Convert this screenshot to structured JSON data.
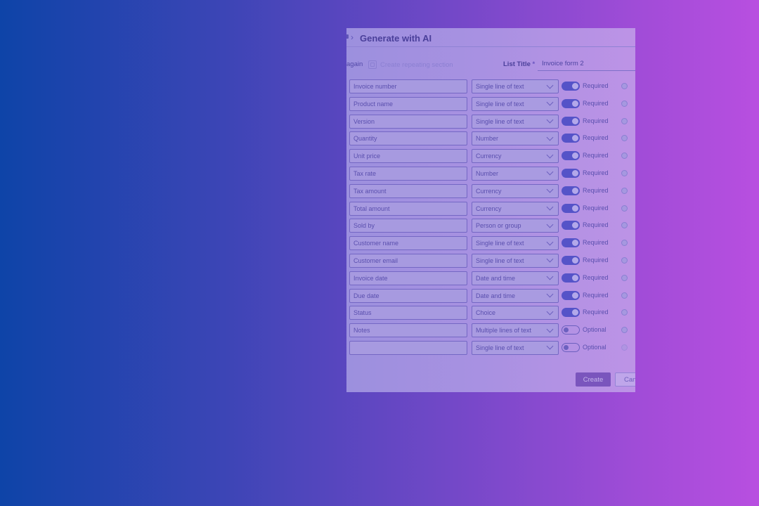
{
  "panel": {
    "title": "Generate with AI",
    "toolbar": {
      "try_again_label": "again",
      "repeating_section_label": "Create repeating section"
    },
    "list_title": {
      "label": "List Title",
      "required_mark": "*",
      "value": "Invoice form 2"
    }
  },
  "fields": [
    {
      "name": "Invoice number",
      "type": "Single line of text",
      "required": true,
      "required_label": "Required"
    },
    {
      "name": "Product name",
      "type": "Single line of text",
      "required": true,
      "required_label": "Required"
    },
    {
      "name": "Version",
      "type": "Single line of text",
      "required": true,
      "required_label": "Required"
    },
    {
      "name": "Quantity",
      "type": "Number",
      "required": true,
      "required_label": "Required"
    },
    {
      "name": "Unit price",
      "type": "Currency",
      "required": true,
      "required_label": "Required"
    },
    {
      "name": "Tax rate",
      "type": "Number",
      "required": true,
      "required_label": "Required"
    },
    {
      "name": "Tax amount",
      "type": "Currency",
      "required": true,
      "required_label": "Required"
    },
    {
      "name": "Total amount",
      "type": "Currency",
      "required": true,
      "required_label": "Required"
    },
    {
      "name": "Sold by",
      "type": "Person or group",
      "required": true,
      "required_label": "Required"
    },
    {
      "name": "Customer name",
      "type": "Single line of text",
      "required": true,
      "required_label": "Required"
    },
    {
      "name": "Customer email",
      "type": "Single line of text",
      "required": true,
      "required_label": "Required"
    },
    {
      "name": "Invoice date",
      "type": "Date and time",
      "required": true,
      "required_label": "Required"
    },
    {
      "name": "Due date",
      "type": "Date and time",
      "required": true,
      "required_label": "Required"
    },
    {
      "name": "Status",
      "type": "Choice",
      "required": true,
      "required_label": "Required"
    },
    {
      "name": "Notes",
      "type": "Multiple lines of text",
      "required": false,
      "required_label": "Optional"
    },
    {
      "name": "",
      "type": "Single line of text",
      "required": false,
      "required_label": "Optional"
    }
  ],
  "actions": {
    "create_label": "Create",
    "cancel_label": "Can"
  },
  "colors": {
    "accent": "#5553c8",
    "primary_button": "#7a55bd"
  }
}
